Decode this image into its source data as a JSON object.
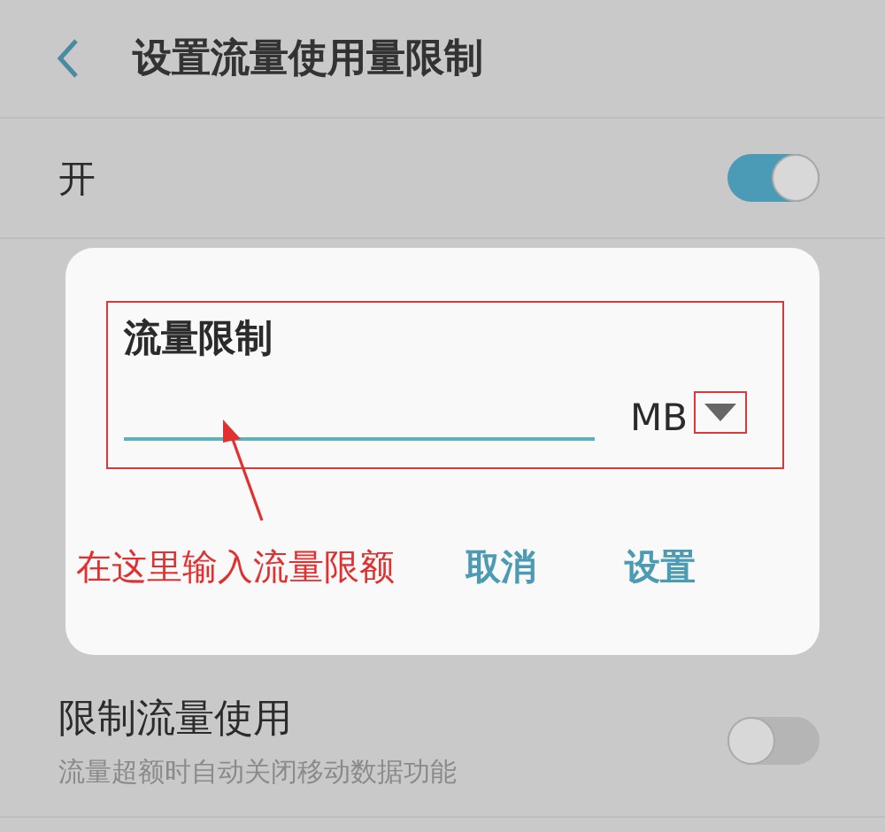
{
  "header": {
    "title": "设置流量使用量限制"
  },
  "master_switch": {
    "label": "开",
    "on": true
  },
  "dialog": {
    "title": "流量限制",
    "unit": "MB",
    "buttons": [
      {
        "label": "取消"
      },
      {
        "label": "设置"
      }
    ]
  },
  "annotation": {
    "text": "在这里输入流量限额"
  },
  "limit_row": {
    "title": "限制流量使用",
    "subtitle": "流量超额时自动关闭移动数据功能",
    "on": false
  }
}
